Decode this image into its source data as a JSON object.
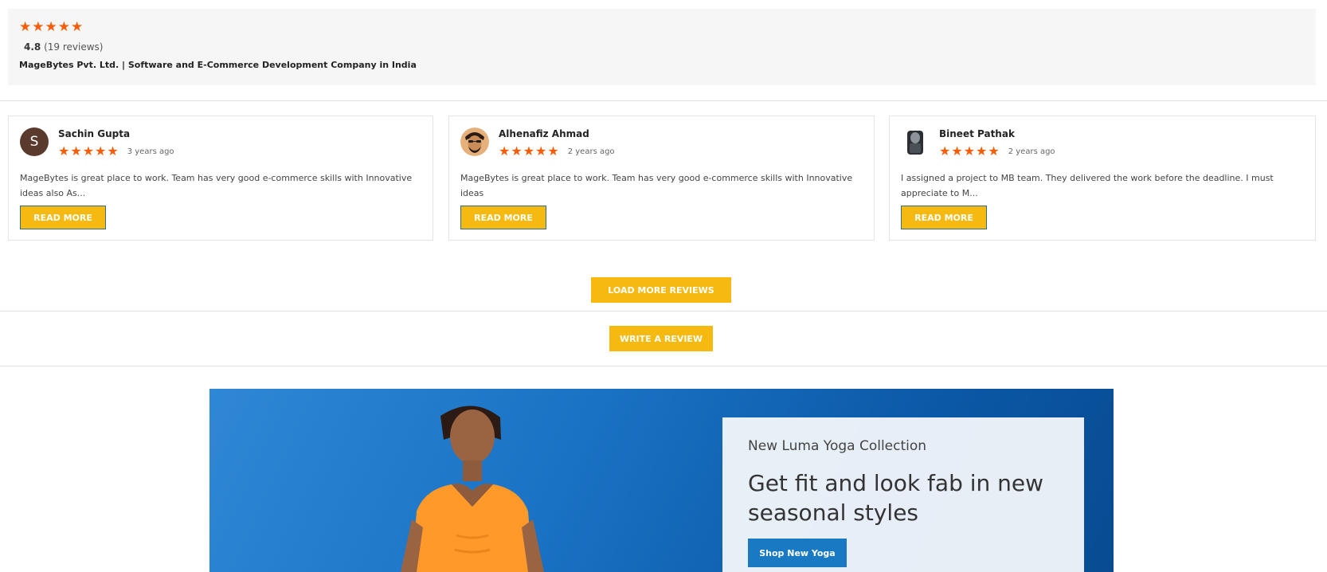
{
  "summary": {
    "stars": "★★★★★",
    "rating_value": "4.8",
    "review_count": "(19 reviews)",
    "company": "MageBytes Pvt. Ltd. | Software and E-Commerce Development Company in India"
  },
  "reviews": [
    {
      "avatar_letter": "S",
      "name": "Sachin Gupta",
      "stars": "★★★★★",
      "time": "3 years ago",
      "text": "MageBytes is great place to work. Team has very good e-commerce skills with Innovative ideas also As...",
      "button": "READ MORE"
    },
    {
      "name": "Alhenafiz Ahmad",
      "stars": "★★★★★",
      "time": "2 years ago",
      "text": "MageBytes is great place to work. Team has very good e-commerce skills with Innovative ideas",
      "button": "READ MORE"
    },
    {
      "name": "Bineet Pathak",
      "stars": "★★★★★",
      "time": "2 years ago",
      "text": "I assigned a project to MB team. They delivered the work before the deadline. I must appreciate to M...",
      "button": "READ MORE"
    }
  ],
  "actions": {
    "load_more": "LOAD MORE REVIEWS",
    "write_review": "WRITE A REVIEW"
  },
  "banner": {
    "subtitle": "New Luma Yoga Collection",
    "title": "Get fit and look fab in new seasonal styles",
    "button": "Shop New Yoga"
  },
  "colors": {
    "star": "#f55d09",
    "button_yellow": "#f5b90f",
    "banner_button": "#1979c3"
  }
}
